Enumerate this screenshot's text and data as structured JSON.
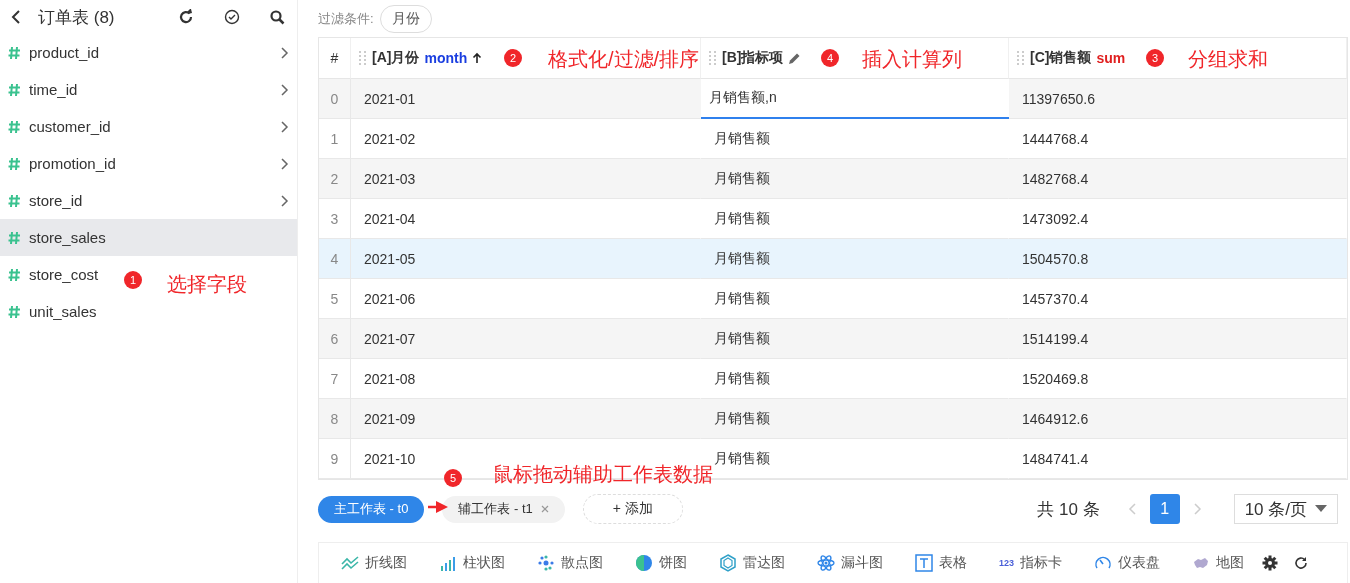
{
  "sidebar": {
    "title": "订单表 (8)",
    "fields": [
      {
        "name": "product_id",
        "expandable": true,
        "selected": false
      },
      {
        "name": "time_id",
        "expandable": true,
        "selected": false
      },
      {
        "name": "customer_id",
        "expandable": true,
        "selected": false
      },
      {
        "name": "promotion_id",
        "expandable": true,
        "selected": false
      },
      {
        "name": "store_id",
        "expandable": true,
        "selected": false
      },
      {
        "name": "store_sales",
        "expandable": false,
        "selected": true
      },
      {
        "name": "store_cost",
        "expandable": false,
        "selected": false
      },
      {
        "name": "unit_sales",
        "expandable": false,
        "selected": false
      }
    ]
  },
  "filter": {
    "label": "过滤条件:",
    "chip": "月份"
  },
  "table": {
    "index_header": "#",
    "columns": [
      {
        "label": "[A]月份",
        "tag": {
          "text": "month",
          "color": "#1a3ee0"
        },
        "sorted": true,
        "editable": false
      },
      {
        "label": "[B]指标项",
        "sorted": false,
        "editable": true
      },
      {
        "label": "[C]销售额",
        "tag": {
          "text": "sum",
          "color": "#e02020"
        },
        "sorted": false,
        "editable": false
      }
    ],
    "rows": [
      {
        "index": "0",
        "cells": [
          "2021-01",
          "月销售额,n",
          "11397650.6"
        ],
        "editing": true,
        "selected": false
      },
      {
        "index": "1",
        "cells": [
          "2021-02",
          "月销售额",
          "1444768.4"
        ],
        "editing": false,
        "selected": false
      },
      {
        "index": "2",
        "cells": [
          "2021-03",
          "月销售额",
          "1482768.4"
        ],
        "editing": false,
        "selected": false
      },
      {
        "index": "3",
        "cells": [
          "2021-04",
          "月销售额",
          "1473092.4"
        ],
        "editing": false,
        "selected": false
      },
      {
        "index": "4",
        "cells": [
          "2021-05",
          "月销售额",
          "1504570.8"
        ],
        "editing": false,
        "selected": true
      },
      {
        "index": "5",
        "cells": [
          "2021-06",
          "月销售额",
          "1457370.4"
        ],
        "editing": false,
        "selected": false
      },
      {
        "index": "6",
        "cells": [
          "2021-07",
          "月销售额",
          "1514199.4"
        ],
        "editing": false,
        "selected": false
      },
      {
        "index": "7",
        "cells": [
          "2021-08",
          "月销售额",
          "1520469.8"
        ],
        "editing": false,
        "selected": false
      },
      {
        "index": "8",
        "cells": [
          "2021-09",
          "月销售额",
          "1464912.6"
        ],
        "editing": false,
        "selected": false
      },
      {
        "index": "9",
        "cells": [
          "2021-10",
          "月销售额",
          "1484741.4"
        ],
        "editing": false,
        "selected": false
      }
    ]
  },
  "sheets": [
    {
      "label": "主工作表 - t0",
      "selected": true,
      "closable": false
    },
    {
      "label": "辅工作表 - t1",
      "selected": false,
      "closable": true
    }
  ],
  "add_button": "+ 添加",
  "pagination": {
    "total": "共 10 条",
    "pages": [
      {
        "label": "1",
        "selected": true
      }
    ],
    "page_size": "10 条/页"
  },
  "chart_types": [
    {
      "kind": "line",
      "label": "折线图"
    },
    {
      "kind": "bar",
      "label": "柱状图"
    },
    {
      "kind": "scatter",
      "label": "散点图"
    },
    {
      "kind": "pie",
      "label": "饼图"
    },
    {
      "kind": "radar",
      "label": "雷达图"
    },
    {
      "kind": "funnel",
      "label": "漏斗图"
    },
    {
      "kind": "table",
      "label": "表格"
    },
    {
      "kind": "kpi",
      "label": "指标卡",
      "badge": "123"
    },
    {
      "kind": "gauge",
      "label": "仪表盘"
    },
    {
      "kind": "map",
      "label": "地图"
    }
  ],
  "annotations": [
    {
      "number": "1",
      "text": "选择字段"
    },
    {
      "number": "2",
      "text": "格式化/过滤/排序"
    },
    {
      "number": "4",
      "text": "插入计算列"
    },
    {
      "number": "3",
      "text": "分组求和"
    },
    {
      "number": "5",
      "text": "鼠标拖动辅助工作表数据"
    }
  ]
}
